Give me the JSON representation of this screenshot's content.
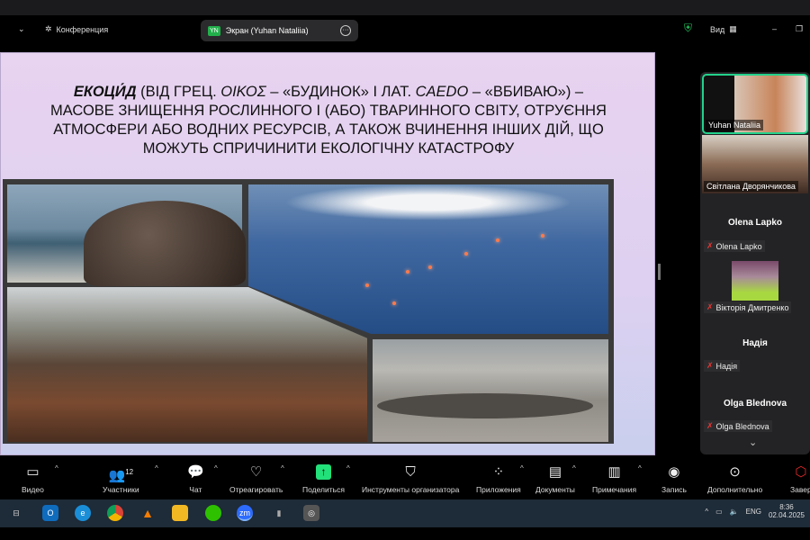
{
  "header": {
    "meeting_label": "Конференция",
    "share_avatar": "YN",
    "share_label": "Экран (Yuhan Nataliia)",
    "view_label": "Вид"
  },
  "slide": {
    "term": "ЕКОЦИ́Д",
    "line1_rest": " (ВІД ГРЕЦ. ",
    "oikos": "ΟΙΚΟΣ",
    "line1_b": " – «БУДИНОК» І ЛАТ. ",
    "caedo": "CAEDO",
    "line1_c": " – «ВБИВАЮ») –",
    "line2": "МАСОВЕ ЗНИЩЕННЯ РОСЛИННОГО І (АБО) ТВАРИННОГО СВІТУ, ОТРУЄННЯ",
    "line3": "АТМОСФЕРИ АБО ВОДНИХ РЕСУРСІВ, А ТАКОЖ ВЧИНЕННЯ ІНШИХ ДІЙ, ЩО",
    "line4": "МОЖУТЬ СПРИЧИНИТИ ЕКОЛОГІЧНУ КАТАСТРОФУ"
  },
  "participants": [
    {
      "name": "Yuhan Nataliia",
      "video": true,
      "active": true
    },
    {
      "name": "Світлана Дворянчикова",
      "video": true
    },
    {
      "name": "Olena Lapko",
      "video": false,
      "muted": true
    },
    {
      "name": "Вікторія Дмитренко",
      "video": true,
      "muted": true
    },
    {
      "name": "Надія",
      "video": false,
      "muted": true
    },
    {
      "name": "Olga Blednova",
      "video": false,
      "muted": true
    }
  ],
  "toolbar": {
    "video": "Видео",
    "participants": "Участники",
    "participants_count": "12",
    "chat": "Чат",
    "react": "Отреагировать",
    "share": "Поделиться",
    "host_tools": "Инструменты организатора",
    "apps": "Приложения",
    "docs": "Документы",
    "notes": "Примечания",
    "record": "Запись",
    "more": "Дополнительно",
    "end": "Завер"
  },
  "taskbar": {
    "lang": "ENG",
    "time": "8:36",
    "date": "02.04.2025"
  },
  "colors": {
    "accent_green": "#23d18b",
    "share_green": "#22e07a",
    "mute_red": "#e53935",
    "end_red": "#e02828"
  }
}
